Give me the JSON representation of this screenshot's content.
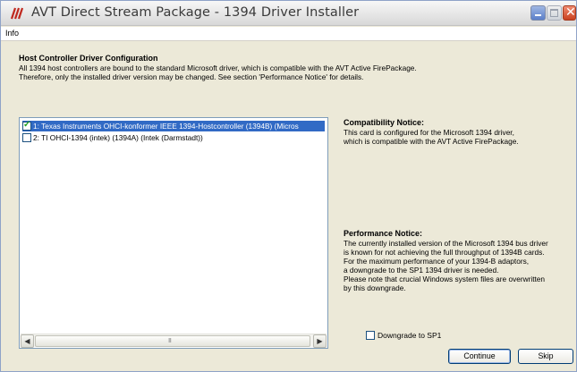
{
  "window": {
    "title": "AVT Direct Stream Package - 1394 Driver Installer",
    "controls": {
      "minimize": "minimize",
      "maximize": "maximize",
      "close": "close"
    }
  },
  "menu": {
    "items": [
      "Info"
    ]
  },
  "header": {
    "title": "Host Controller Driver Configuration",
    "description_lines": [
      "All 1394 host controllers are bound to the standard Microsoft driver, which is compatible with the AVT Active FirePackage.",
      "Therefore, only the installed driver version may be changed. See section 'Performance Notice' for details."
    ]
  },
  "controllers": [
    {
      "label": "1: Texas Instruments OHCI-konformer IEEE 1394-Hostcontroller (1394B)  (Micros",
      "checked": true,
      "selected": true
    },
    {
      "label": "2: TI OHCI-1394 (intek) (1394A)  (Intek (Darmstadt))",
      "checked": false,
      "selected": false
    }
  ],
  "compatibility": {
    "title": "Compatibility Notice:",
    "lines": [
      "This card is configured for the Microsoft 1394 driver,",
      "which is compatible with the AVT Active FirePackage."
    ]
  },
  "performance": {
    "title": "Performance Notice:",
    "lines": [
      "The currently installed version of the Microsoft 1394 bus driver",
      "is known for not achieving the full throughput of 1394B cards.",
      "For the maximum performance of your 1394-B adaptors,",
      "a downgrade to the SP1 1394 driver is needed.",
      "Please note that crucial Windows system files are overwritten",
      "by this downgrade."
    ]
  },
  "downgrade": {
    "label": "Downgrade to SP1",
    "checked": false
  },
  "buttons": {
    "continue": "Continue",
    "skip": "Skip"
  },
  "icons": {
    "app": "avt-logo-icon",
    "scroll_left": "◀",
    "scroll_right": "▶",
    "thumb_grip": "III"
  },
  "colors": {
    "selection": "#316ac5",
    "dialog_bg": "#ece9d8",
    "close_button": "#c9401f"
  }
}
